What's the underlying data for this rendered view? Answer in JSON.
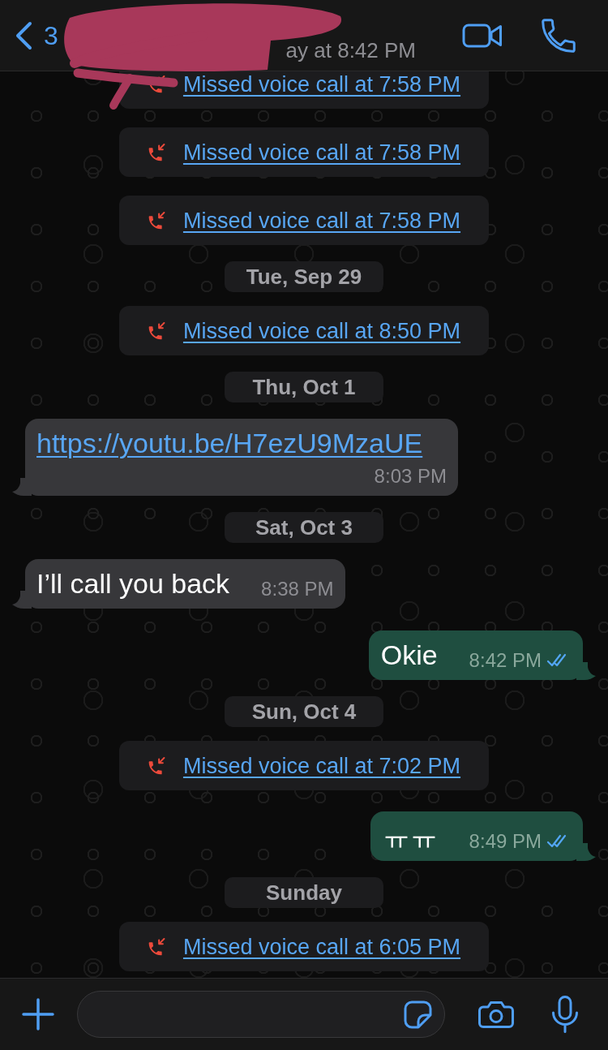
{
  "header": {
    "back_count": "3",
    "status": "ay at 8:42 PM"
  },
  "messages": [
    {
      "kind": "call",
      "text": "Missed voice call at 7:58 PM"
    },
    {
      "kind": "call",
      "text": "Missed voice call at 7:58 PM"
    },
    {
      "kind": "call",
      "text": "Missed voice call at 7:58 PM"
    },
    {
      "kind": "date",
      "text": "Tue, Sep 29"
    },
    {
      "kind": "call",
      "text": "Missed voice call at 8:50 PM"
    },
    {
      "kind": "date",
      "text": "Thu, Oct 1"
    },
    {
      "kind": "incoming",
      "text": "https://youtu.be/H7ezU9MzaUE",
      "link": true,
      "time": "8:03 PM"
    },
    {
      "kind": "date",
      "text": "Sat, Oct 3"
    },
    {
      "kind": "incoming",
      "text": "I’ll call you back",
      "link": false,
      "time": "8:38 PM"
    },
    {
      "kind": "outgoing",
      "text": "Okie",
      "time": "8:42 PM",
      "read": true
    },
    {
      "kind": "date",
      "text": "Sun, Oct 4"
    },
    {
      "kind": "call",
      "text": "Missed voice call at 7:02 PM"
    },
    {
      "kind": "outgoing",
      "text": "ㅠㅠ",
      "time": "8:49 PM",
      "read": true
    },
    {
      "kind": "date",
      "text": "Sunday"
    },
    {
      "kind": "call",
      "text": "Missed voice call at 6:05 PM"
    }
  ]
}
